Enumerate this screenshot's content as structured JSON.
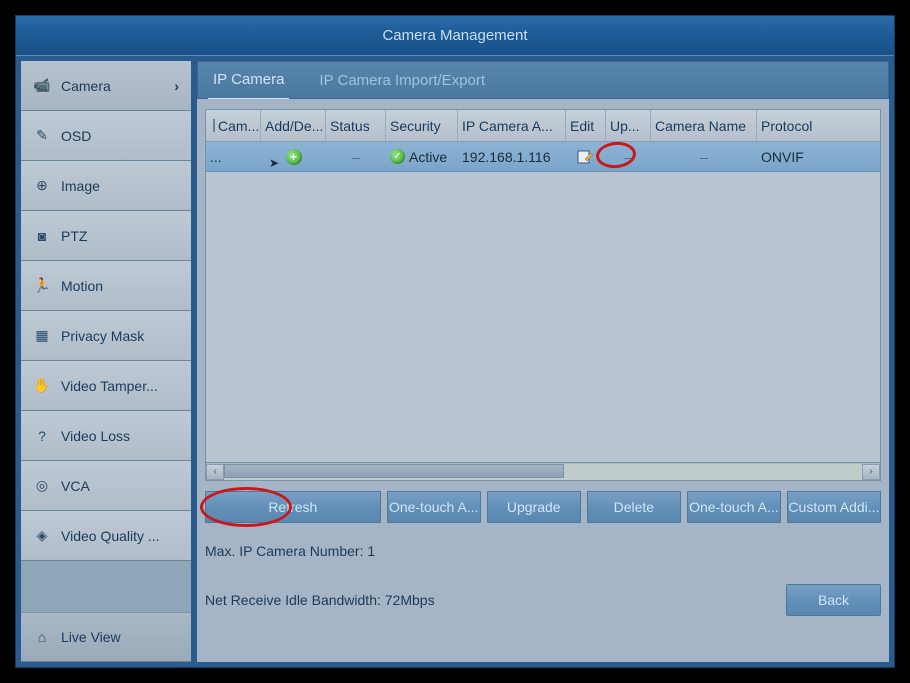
{
  "title": "Camera Management",
  "sidebar": {
    "items": [
      {
        "label": "Camera",
        "icon": "📹"
      },
      {
        "label": "OSD",
        "icon": "✎"
      },
      {
        "label": "Image",
        "icon": "⊕"
      },
      {
        "label": "PTZ",
        "icon": "◙"
      },
      {
        "label": "Motion",
        "icon": "🏃"
      },
      {
        "label": "Privacy Mask",
        "icon": "▦"
      },
      {
        "label": "Video Tamper...",
        "icon": "✋"
      },
      {
        "label": "Video Loss",
        "icon": "?"
      },
      {
        "label": "VCA",
        "icon": "◎"
      },
      {
        "label": "Video Quality ...",
        "icon": "◈"
      }
    ],
    "liveview": {
      "label": "Live View",
      "icon": "⌂"
    }
  },
  "tabs": {
    "ipcamera": "IP Camera",
    "importexport": "IP Camera Import/Export"
  },
  "table": {
    "headers": {
      "cam": "Cam...",
      "add": "Add/De...",
      "status": "Status",
      "security": "Security",
      "ipaddr": "IP Camera A...",
      "edit": "Edit",
      "up": "Up...",
      "name": "Camera Name",
      "proto": "Protocol"
    },
    "rows": [
      {
        "cam": "...",
        "status": "–",
        "security": "Active",
        "ipaddr": "192.168.1.116",
        "up": "–",
        "name": "–",
        "proto": "ONVIF"
      }
    ]
  },
  "buttons": {
    "refresh": "Refresh",
    "onetouch1": "One-touch A...",
    "upgrade": "Upgrade",
    "delete": "Delete",
    "onetouch2": "One-touch A...",
    "custom": "Custom Addi..."
  },
  "info": {
    "maxnum": "Max. IP Camera Number: 1",
    "bandwidth": "Net Receive Idle Bandwidth: 72Mbps"
  },
  "back": "Back"
}
